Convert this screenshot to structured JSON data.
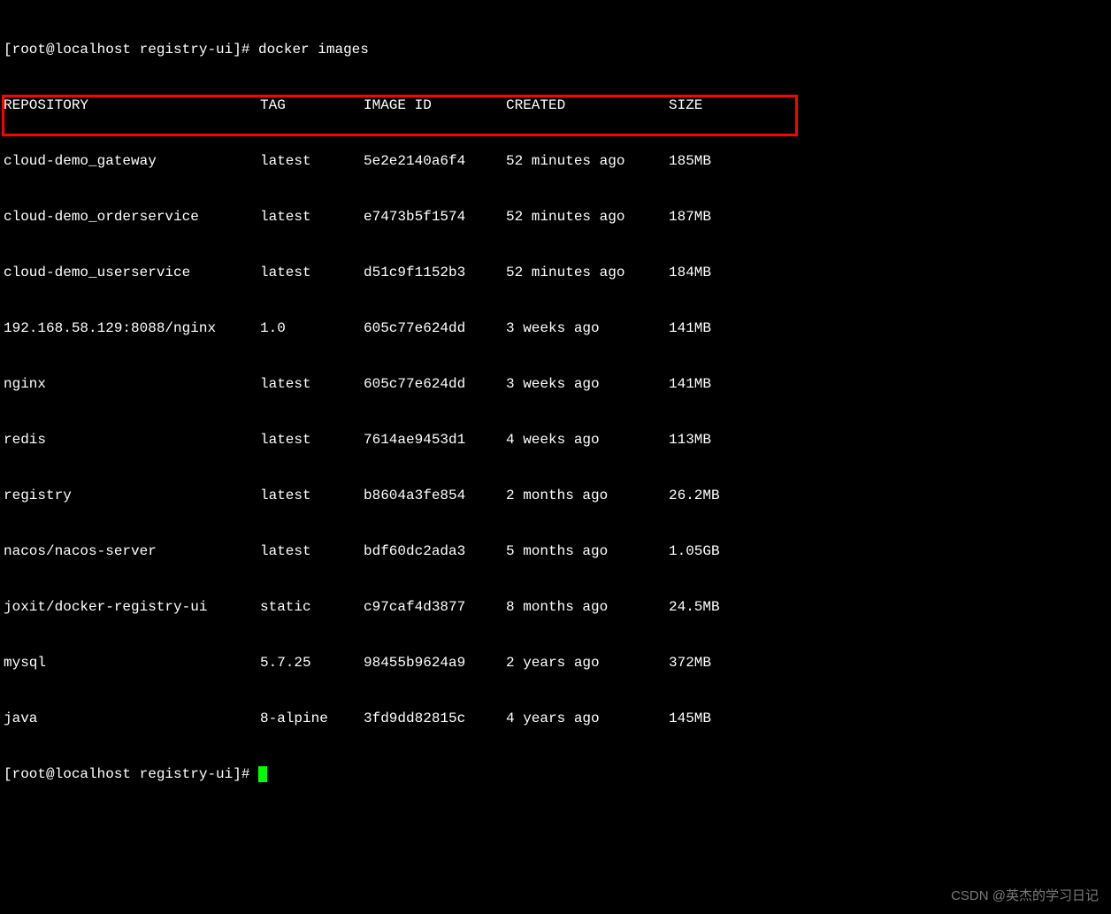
{
  "prompt1": {
    "prefix": "[root@localhost registry-ui]# ",
    "command": "docker images"
  },
  "headers": {
    "repository": "REPOSITORY",
    "tag": "TAG",
    "image_id": "IMAGE ID",
    "created": "CREATED",
    "size": "SIZE"
  },
  "rows": [
    {
      "repository": "cloud-demo_gateway",
      "tag": "latest",
      "image_id": "5e2e2140a6f4",
      "created": "52 minutes ago",
      "size": "185MB"
    },
    {
      "repository": "cloud-demo_orderservice",
      "tag": "latest",
      "image_id": "e7473b5f1574",
      "created": "52 minutes ago",
      "size": "187MB"
    },
    {
      "repository": "cloud-demo_userservice",
      "tag": "latest",
      "image_id": "d51c9f1152b3",
      "created": "52 minutes ago",
      "size": "184MB"
    },
    {
      "repository": "192.168.58.129:8088/nginx",
      "tag": "1.0",
      "image_id": "605c77e624dd",
      "created": "3 weeks ago",
      "size": "141MB"
    },
    {
      "repository": "nginx",
      "tag": "latest",
      "image_id": "605c77e624dd",
      "created": "3 weeks ago",
      "size": "141MB"
    },
    {
      "repository": "redis",
      "tag": "latest",
      "image_id": "7614ae9453d1",
      "created": "4 weeks ago",
      "size": "113MB"
    },
    {
      "repository": "registry",
      "tag": "latest",
      "image_id": "b8604a3fe854",
      "created": "2 months ago",
      "size": "26.2MB"
    },
    {
      "repository": "nacos/nacos-server",
      "tag": "latest",
      "image_id": "bdf60dc2ada3",
      "created": "5 months ago",
      "size": "1.05GB"
    },
    {
      "repository": "joxit/docker-registry-ui",
      "tag": "static",
      "image_id": "c97caf4d3877",
      "created": "8 months ago",
      "size": "24.5MB"
    },
    {
      "repository": "mysql",
      "tag": "5.7.25",
      "image_id": "98455b9624a9",
      "created": "2 years ago",
      "size": "372MB"
    },
    {
      "repository": "java",
      "tag": "8-alpine",
      "image_id": "3fd9dd82815c",
      "created": "4 years ago",
      "size": "145MB"
    }
  ],
  "prompt2": {
    "prefix": "[root@localhost registry-ui]# "
  },
  "watermark": "CSDN @英杰的学习日记"
}
